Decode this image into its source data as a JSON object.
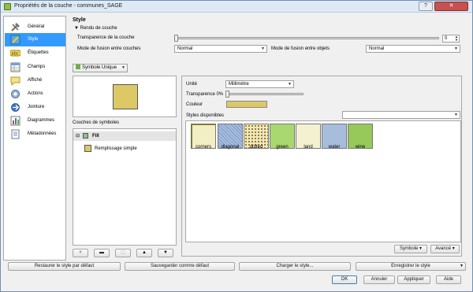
{
  "window": {
    "title": "Propriétés de la couche - communes_SAGE"
  },
  "sidebar": {
    "items": [
      {
        "label": "Général",
        "icon": "wrench-hammer-icon"
      },
      {
        "label": "Style",
        "icon": "brush-style-icon"
      },
      {
        "label": "Étiquettes",
        "icon": "abc-label-icon"
      },
      {
        "label": "Champs",
        "icon": "table-fields-icon"
      },
      {
        "label": "Affiché",
        "icon": "speech-bubble-icon"
      },
      {
        "label": "Actions",
        "icon": "gear-actions-icon"
      },
      {
        "label": "Jointure",
        "icon": "join-arrow-icon"
      },
      {
        "label": "Diagrammes",
        "icon": "chart-icon"
      },
      {
        "label": "Métadonnées",
        "icon": "metadata-doc-icon"
      }
    ]
  },
  "style": {
    "title": "Style",
    "rendu_label": "Rendu de couche",
    "transparence_couche_label": "Transparence de la couche",
    "transparence_couche_value": "0",
    "fusion_couches_label": "Mode de fusion entre couches",
    "fusion_couches_value": "Normal",
    "fusion_objets_label": "Mode de fusion entre objets",
    "fusion_objets_value": "Normal",
    "renderer_value": "Symbole Unique"
  },
  "layers": {
    "header": "Couches de symboles",
    "fill_label": "Fill",
    "sub_label": "Remplissage simple"
  },
  "props": {
    "unite_label": "Unité",
    "unite_value": "Millimètre",
    "transparence_label": "Transparence 0%",
    "couleur_label": "Couleur",
    "styles_label": "Styles disponibles",
    "styles_value": ""
  },
  "symbols": [
    {
      "label": "corners",
      "color": "#f3efc5"
    },
    {
      "label": "diagonal",
      "color": "#a9bfde"
    },
    {
      "label": "dotted",
      "color": "#f3e8b8"
    },
    {
      "label": "green",
      "color": "#a8d86f"
    },
    {
      "label": "land",
      "color": "#f3f1cf"
    },
    {
      "label": "water",
      "color": "#a7bddb"
    },
    {
      "label": "wine",
      "color": "#96c85a"
    }
  ],
  "buttons": {
    "symbole": "Symbole",
    "avance": "Avancé",
    "restaurer": "Restaurer le style par défaut",
    "sauvegarder": "Sauvegarder comme défaut",
    "charger": "Charger le style...",
    "enregistrer": "Enregistrer le style",
    "ok": "OK",
    "annuler": "Annuler",
    "appliquer": "Appliquer",
    "aide": "Aide"
  },
  "colors": {
    "fill": "#ddc866",
    "selection": "#3399ff"
  }
}
